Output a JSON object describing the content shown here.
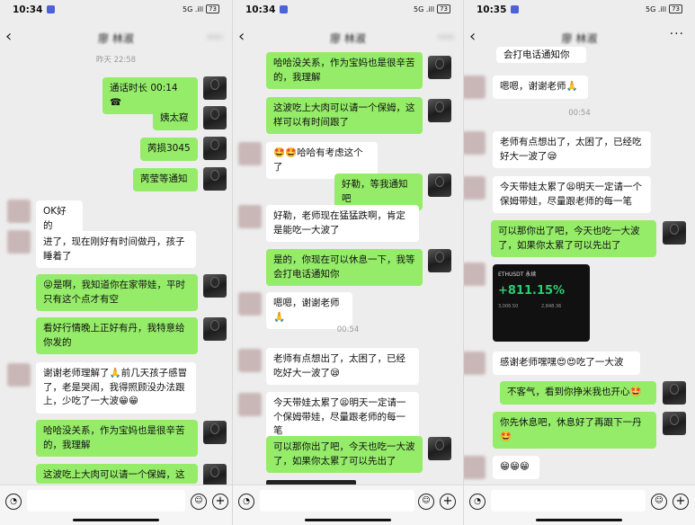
{
  "screens": [
    {
      "status_time": "10:34",
      "title": "廖 林淑",
      "day_label": "昨天 22:58",
      "messages": [
        {
          "text": "通话时长 00:14 ☎"
        },
        {
          "text": "姨太窥"
        },
        {
          "text": "苪损3045"
        },
        {
          "text": "苪莹等通知"
        },
        {
          "text": "OK好的"
        },
        {
          "text": "进了，现在刚好有时间做丹，孩子睡着了"
        },
        {
          "text": "😜是啊，我知道你在家带娃，平时只有这个点才有空"
        },
        {
          "text": "看好行情晚上正好有丹，我特意给你发的"
        },
        {
          "text": "谢谢老师理解了🙏前几天孩子感冒了，老是哭闹，我得照顾没办法跟上，少吃了一大波😁😁"
        },
        {
          "text": "哈哈没关系，作为宝妈也是很辛苦的，我理解"
        },
        {
          "text": "这波吃上大肉可以请一个保姆，这"
        }
      ]
    },
    {
      "status_time": "10:34",
      "title": "廖 林淑",
      "time_label": "00:54",
      "messages": [
        {
          "text": "哈哈没关系，作为宝妈也是很辛苦的，我理解"
        },
        {
          "text": "这波吃上大肉可以请一个保姆，这样可以有时间跟了"
        },
        {
          "text": "🤩🤩哈哈有考虑这个了"
        },
        {
          "text": "好勒，等我通知吧"
        },
        {
          "text": "好勒，老师现在猛猛跌啊，肯定是能吃一大波了"
        },
        {
          "text": "是的，你现在可以休息一下，我等会打电话通知你"
        },
        {
          "text": "嗯嗯，谢谢老师🙏"
        },
        {
          "text": "老师有点想出了，太困了，已经吃好大一波了😪"
        },
        {
          "text": "今天带娃太累了😫明天一定请一个保姆带娃，尽量跟老师的每一笔"
        },
        {
          "text": "可以那你出了吧，今天也吃一大波了，如果你太累了可以先出了"
        }
      ]
    },
    {
      "status_time": "10:35",
      "title": "廖 林淑",
      "time_label": "00:54",
      "messages": [
        {
          "text": "会打电话通知你"
        },
        {
          "text": "嗯嗯，谢谢老师🙏"
        },
        {
          "text": "老师有点想出了，太困了，已经吃好大一波了😪"
        },
        {
          "text": "今天带娃太累了😫明天一定请一个保姆带娃，尽量跟老师的每一笔"
        },
        {
          "text": "可以那你出了吧，今天也吃一大波了，如果你太累了可以先出了"
        },
        {
          "text": "感谢老师嘿嘿😍😍吃了一大波"
        },
        {
          "text": "不客气，看到你挣米我也开心🤩"
        },
        {
          "text": "你先休息吧，休息好了再跟下一丹🤩"
        },
        {
          "text": "😁😁😁"
        }
      ],
      "screenshot": {
        "symbol": "ETHUSDT 永续",
        "percent": "+811.15%",
        "v1": "3,006.50",
        "v2": "2,848.36"
      }
    }
  ],
  "status_right": "5G .ill",
  "battery": "73",
  "icons": {
    "back": "‹",
    "more": "···",
    "voice": "◔",
    "emoji": "☺",
    "plus": "+"
  }
}
